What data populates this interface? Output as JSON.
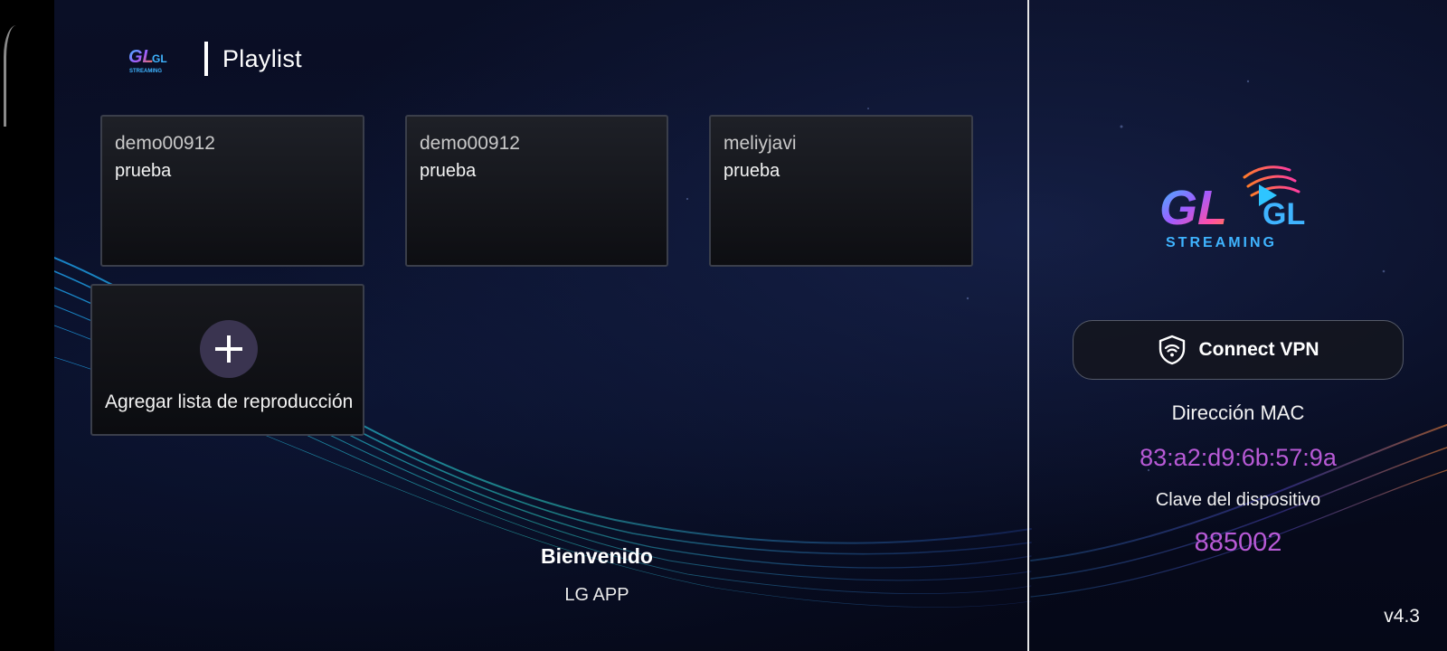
{
  "header": {
    "logo_icon": "gl-streaming-logo",
    "title": "Playlist"
  },
  "playlists": [
    {
      "name": "demo00912",
      "subtitle": "prueba"
    },
    {
      "name": "demo00912",
      "subtitle": "prueba"
    },
    {
      "name": "meliyjavi",
      "subtitle": "prueba"
    }
  ],
  "add_playlist": {
    "icon": "plus-icon",
    "label": "Agregar lista de reproducción"
  },
  "welcome": {
    "title": "Bienvenido",
    "subtitle": "LG APP"
  },
  "sidebar": {
    "logo_icon": "gl-streaming-logo",
    "logo_text_main": "GL",
    "logo_text_sub": "STREAMING",
    "vpn_button_icon": "shield-wifi-icon",
    "vpn_button_label": "Connect VPN",
    "mac_label": "Dirección MAC",
    "mac_value": "83:a2:d9:6b:57:9a",
    "device_key_label": "Clave del dispositivo",
    "device_key_value": "885002",
    "version": "v4.3"
  },
  "colors": {
    "background": "#070b1f",
    "accent_purple": "#b85ad6",
    "card_border": "#3a3e4a",
    "divider": "#e6e6e6"
  }
}
